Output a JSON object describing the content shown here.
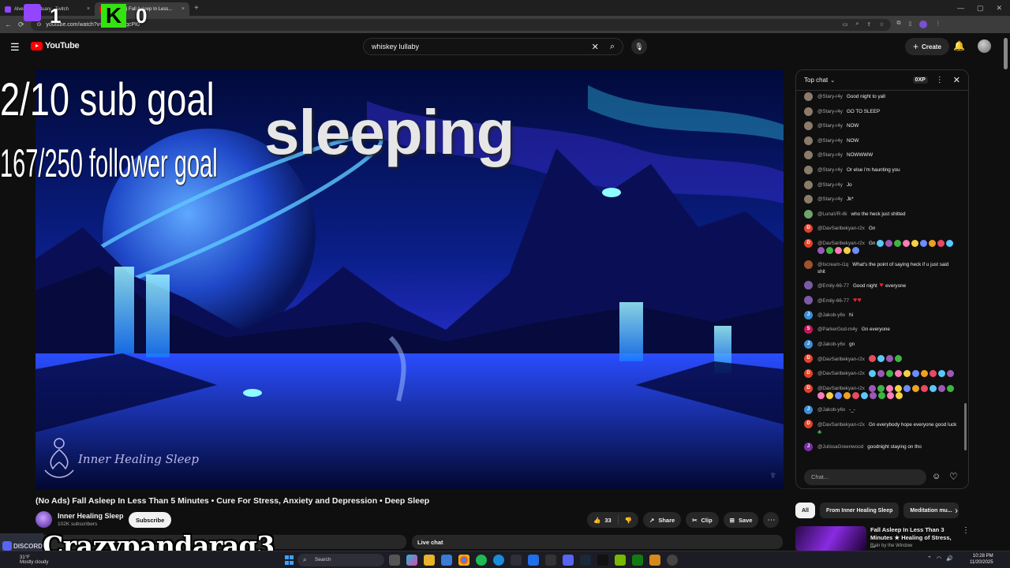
{
  "browser": {
    "tabs": [
      {
        "label": "Alveus Sanctuary - Twitch",
        "color": "#9146ff"
      },
      {
        "label": "(No Ads) Fall Asleep In Less...",
        "color": "#ff0000"
      }
    ],
    "url": "youtube.com/watch?v=...ssCIBZqcPI0"
  },
  "youtube": {
    "logo_text": "YouTube",
    "search_query": "whiskey lullaby",
    "create_label": "Create"
  },
  "video": {
    "title": "(No Ads) Fall Asleep In Less Than 5 Minutes • Cure For Stress, Anxiety and Depression • Deep Sleep",
    "watermark": "Inner Healing Sleep",
    "channel_name": "Inner Healing Sleep",
    "subscribers": "102K subscribers",
    "subscribe_label": "Subscribe",
    "likes": "33",
    "share_label": "Share",
    "clip_label": "Clip",
    "save_label": "Save",
    "live_chat_label": "Live chat"
  },
  "overlay": {
    "score_left": "1",
    "kick_letter": "K",
    "score_right": "0",
    "sub_goal": "2/10 sub goal",
    "follower_goal": "167/250 follower goal",
    "status": "sleeping",
    "streamer_name": "Crazypandarag3",
    "discord_label": "DISCORD"
  },
  "chat": {
    "header": "Top chat",
    "xp_badge": "0XP",
    "input_placeholder": "Chat...",
    "messages": [
      {
        "author": "@Stary-r4y",
        "text": "Good night to yall",
        "av": "#8b7b6b",
        "init": ""
      },
      {
        "author": "@Stary-r4y",
        "text": "GO TO SLEEP",
        "av": "#8b7b6b",
        "init": ""
      },
      {
        "author": "@Stary-r4y",
        "text": "NOW",
        "av": "#8b7b6b",
        "init": ""
      },
      {
        "author": "@Stary-r4y",
        "text": "NOW",
        "av": "#8b7b6b",
        "init": ""
      },
      {
        "author": "@Stary-r4y",
        "text": "NOWWWW",
        "av": "#8b7b6b",
        "init": ""
      },
      {
        "author": "@Stary-r4y",
        "text": "Or else i'm haunting you",
        "av": "#8b7b6b",
        "init": ""
      },
      {
        "author": "@Stary-r4y",
        "text": "Jo",
        "av": "#8b7b6b",
        "init": ""
      },
      {
        "author": "@Stary-r4y",
        "text": "Jk*",
        "av": "#8b7b6b",
        "init": ""
      },
      {
        "author": "@LunaVR-i6i",
        "text": "who the heck just shitted",
        "av": "#6fa56a",
        "init": ""
      },
      {
        "author": "@DavSaribekyan-r2x",
        "text": "Gn",
        "av": "#e2412b",
        "init": "D"
      },
      {
        "author": "@DavSaribekyan-r2x",
        "text": "Gn",
        "av": "#e2412b",
        "init": "D",
        "emotes": 14
      },
      {
        "author": "@Iscream-i1q",
        "text": "What's the point of saying heck if u just said shit",
        "av": "#a0522d",
        "init": ""
      },
      {
        "author": "@Emily-66-77",
        "text": "Good night",
        "av": "#7d5aa8",
        "init": "",
        "heart": true,
        "after": "everyone"
      },
      {
        "author": "@Emily-66-77",
        "text": "",
        "av": "#7d5aa8",
        "init": "",
        "hearts": 2
      },
      {
        "author": "@Jakob-y6x",
        "text": "hi",
        "av": "#3b8fd6",
        "init": "J"
      },
      {
        "author": "@ParkerGod-m4y",
        "text": "Gn everyone",
        "av": "#c2185b",
        "init": "S"
      },
      {
        "author": "@Jakob-y6x",
        "text": "gn",
        "av": "#3b8fd6",
        "init": "J"
      },
      {
        "author": "@DavSaribekyan-r2x",
        "text": "",
        "av": "#e2412b",
        "init": "D",
        "emotes": 4
      },
      {
        "author": "@DavSaribekyan-r2x",
        "text": "",
        "av": "#e2412b",
        "init": "D",
        "emotes": 10
      },
      {
        "author": "@DavSaribekyan-r2x",
        "text": "",
        "av": "#e2412b",
        "init": "D",
        "emotes": 20
      },
      {
        "author": "@Jakob-y6x",
        "text": "-_-",
        "av": "#3b8fd6",
        "init": "J"
      },
      {
        "author": "@DavSaribekyan-r2x",
        "text": "Gn everybody hope everyone good luck",
        "av": "#e2412b",
        "init": "D",
        "clover": true
      },
      {
        "author": "@JulissaGreenwood",
        "text": "goodnight staying on tho",
        "av": "#7b2fa8",
        "init": "J"
      }
    ]
  },
  "recs": {
    "chips": [
      "All",
      "From Inner Healing Sleep",
      "Meditation mu..."
    ],
    "title": "Fall Asleep In Less Than 3 Minutes ★ Healing of Stress, ...",
    "channel": "Rain by the Window"
  },
  "taskbar": {
    "weather_temp": "31°F",
    "weather_text": "Mostly cloudy",
    "search_label": "Search",
    "time": "10:28 PM",
    "date": "11/20/2025"
  },
  "colors": {
    "accent": "#ff0000",
    "twitch": "#9146ff",
    "kick": "#32e40f"
  }
}
